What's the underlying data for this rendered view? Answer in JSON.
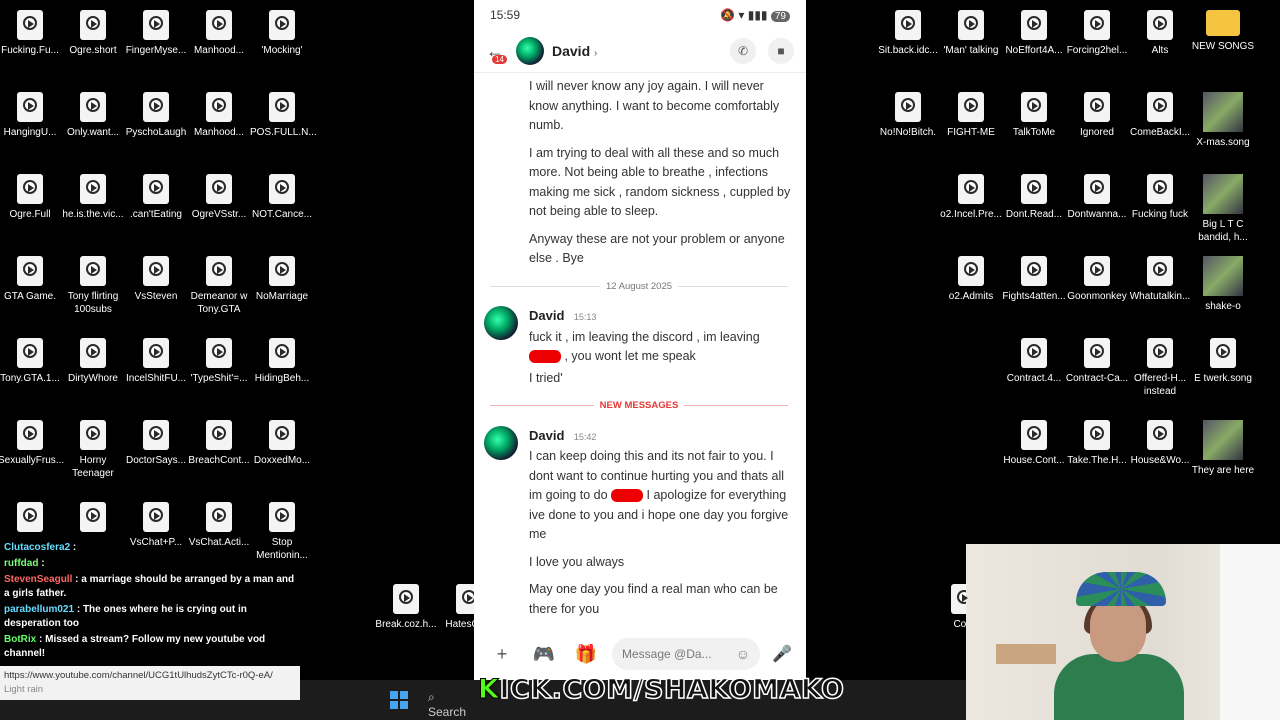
{
  "desktop_left": [
    {
      "label": "Fucking.Fu...",
      "kind": "video"
    },
    {
      "label": "Ogre.short",
      "kind": "video"
    },
    {
      "label": "FingerMyse...",
      "kind": "video"
    },
    {
      "label": "Manhood...",
      "kind": "video"
    },
    {
      "label": "'Mocking'",
      "kind": "video"
    },
    {
      "label": "HangingU...",
      "kind": "video"
    },
    {
      "label": "Only.want...",
      "kind": "video"
    },
    {
      "label": "PyschoLaugh",
      "kind": "video"
    },
    {
      "label": "Manhood...",
      "kind": "video"
    },
    {
      "label": "POS.FULL.N...",
      "kind": "video"
    },
    {
      "label": "Ogre.Full",
      "kind": "video"
    },
    {
      "label": "he.is.the.vic...",
      "kind": "video"
    },
    {
      "label": ".can'tEating",
      "kind": "video"
    },
    {
      "label": "OgreVSstr...",
      "kind": "video"
    },
    {
      "label": "NOT.Cance...",
      "kind": "video"
    },
    {
      "label": "GTA Game.",
      "kind": "video"
    },
    {
      "label": "Tony flirting 100subs",
      "kind": "video"
    },
    {
      "label": "VsSteven",
      "kind": "video"
    },
    {
      "label": "Demeanor w Tony.GTA",
      "kind": "video"
    },
    {
      "label": "NoMarriage",
      "kind": "video"
    },
    {
      "label": "Tony.GTA.1...",
      "kind": "video"
    },
    {
      "label": "DirtyWhore",
      "kind": "video"
    },
    {
      "label": "IncelShitFU...",
      "kind": "video"
    },
    {
      "label": "'TypeShit'=...",
      "kind": "video"
    },
    {
      "label": "HidingBeh...",
      "kind": "video"
    },
    {
      "label": "SexuallyFrus...",
      "kind": "video"
    },
    {
      "label": "Horny Teenager",
      "kind": "video"
    },
    {
      "label": "DoctorSays...",
      "kind": "video"
    },
    {
      "label": "BreachCont...",
      "kind": "video"
    },
    {
      "label": "DoxxedMo...",
      "kind": "video"
    },
    {
      "label": "",
      "kind": "video"
    },
    {
      "label": "",
      "kind": "video"
    },
    {
      "label": "VsChat+P...",
      "kind": "video"
    },
    {
      "label": "VsChat.Acti...",
      "kind": "video"
    },
    {
      "label": "Stop Mentionin...",
      "kind": "video"
    },
    {
      "label": "Break.coz.h...",
      "kind": "video"
    },
    {
      "label": "HatesCo...",
      "kind": "video"
    }
  ],
  "desktop_right": [
    {
      "label": "Sit.back.idc...",
      "kind": "video"
    },
    {
      "label": "'Man' talking",
      "kind": "video"
    },
    {
      "label": "NoEffort4A...",
      "kind": "video"
    },
    {
      "label": "Forcing2hel...",
      "kind": "video"
    },
    {
      "label": "Alts",
      "kind": "video"
    },
    {
      "label": "NEW SONGS",
      "kind": "folder"
    },
    {
      "label": "No!No!Bitch.",
      "kind": "video"
    },
    {
      "label": "FIGHT-ME",
      "kind": "video"
    },
    {
      "label": "TalkToMe",
      "kind": "video"
    },
    {
      "label": "Ignored",
      "kind": "video"
    },
    {
      "label": "ComeBackI...",
      "kind": "video"
    },
    {
      "label": "X-mas.song",
      "kind": "thumb"
    },
    {
      "label": "o2.Incel.Pre...",
      "kind": "video"
    },
    {
      "label": "Dont.Read...",
      "kind": "video"
    },
    {
      "label": "Dontwanna...",
      "kind": "video"
    },
    {
      "label": "Fucking fuck",
      "kind": "video"
    },
    {
      "label": "Big L T C bandid, h...",
      "kind": "thumb"
    },
    {
      "label": "o2.Admits",
      "kind": "video"
    },
    {
      "label": "Fights4atten...",
      "kind": "video"
    },
    {
      "label": "Goonmonkey",
      "kind": "video"
    },
    {
      "label": "Whatutalkin...",
      "kind": "video"
    },
    {
      "label": "shake-o",
      "kind": "thumb"
    },
    {
      "label": "Contract.4...",
      "kind": "video"
    },
    {
      "label": "Contract-Ca...",
      "kind": "video"
    },
    {
      "label": "Offered-H... instead",
      "kind": "video"
    },
    {
      "label": "E twerk.song",
      "kind": "video"
    },
    {
      "label": "House.Cont...",
      "kind": "video"
    },
    {
      "label": "Take.The.H...",
      "kind": "video"
    },
    {
      "label": "House&Wo...",
      "kind": "video"
    },
    {
      "label": "They are here",
      "kind": "thumb"
    },
    {
      "label": "Cont",
      "kind": "video"
    }
  ],
  "phone": {
    "time": "15:59",
    "battery": "79",
    "back_badge": "14",
    "contact_name": "David",
    "call_icon": "phone-icon",
    "video_icon": "video-icon",
    "earlier_lines": [
      "I will never know any joy again. I will never know anything. I want to become comfortably numb.",
      "I am trying to deal with all these and so much more. Not being able to breathe , infections making me sick , random sickness , cuppled by not being able to sleep.",
      "Anyway these are not your problem or anyone else . Bye"
    ],
    "date_divider": "12 August 2025",
    "msg1": {
      "author": "David",
      "time": "15:13",
      "line1": "fuck it , im leaving the discord , im leaving",
      "line2_after_redaction": ", you wont let me speak",
      "line3": "I tried'"
    },
    "new_messages_label": "NEW MESSAGES",
    "msg2": {
      "author": "David",
      "time": "15:42",
      "p1_before_redaction": "I can keep doing this and its not fair to you. I dont want to continue hurting you and thats all im going to do",
      "p1_after_redaction": "I apologize for everything ive done to you and i hope one day you forgive me",
      "p2": "I love you always",
      "p3": "May one day you find a real man who can be there for you"
    },
    "composer_placeholder": "Message @Da...",
    "composer_icons": [
      "plus-icon",
      "gamepad-icon",
      "gift-icon",
      "emoji-icon",
      "mic-icon"
    ]
  },
  "taskbar": {
    "search_label": "Search",
    "overlay_text_k": "K",
    "overlay_text_rest": "ICK.COM/SHAKOMAKO"
  },
  "chat": [
    {
      "user": "Clutacosfera2",
      "text": "",
      "color": "#66ddff"
    },
    {
      "user": "ruffdad",
      "text": "",
      "color": "#7cff7c"
    },
    {
      "user": "StevenSeagull",
      "text": "a marriage should be arranged by a man and a girls father.",
      "color": "#ff6666"
    },
    {
      "user": "parabellum021",
      "text": "The ones where he is crying out in desperation too",
      "color": "#66ddff"
    },
    {
      "user": "BotRix",
      "text": "Missed a stream? Follow my new youtube vod channel!",
      "color": "#66ff66"
    }
  ],
  "chat_link": "https://www.youtube.com/channel/UCG1tUlhudsZytCTc-r0Q-eA/",
  "chat_weather": "Light rain"
}
